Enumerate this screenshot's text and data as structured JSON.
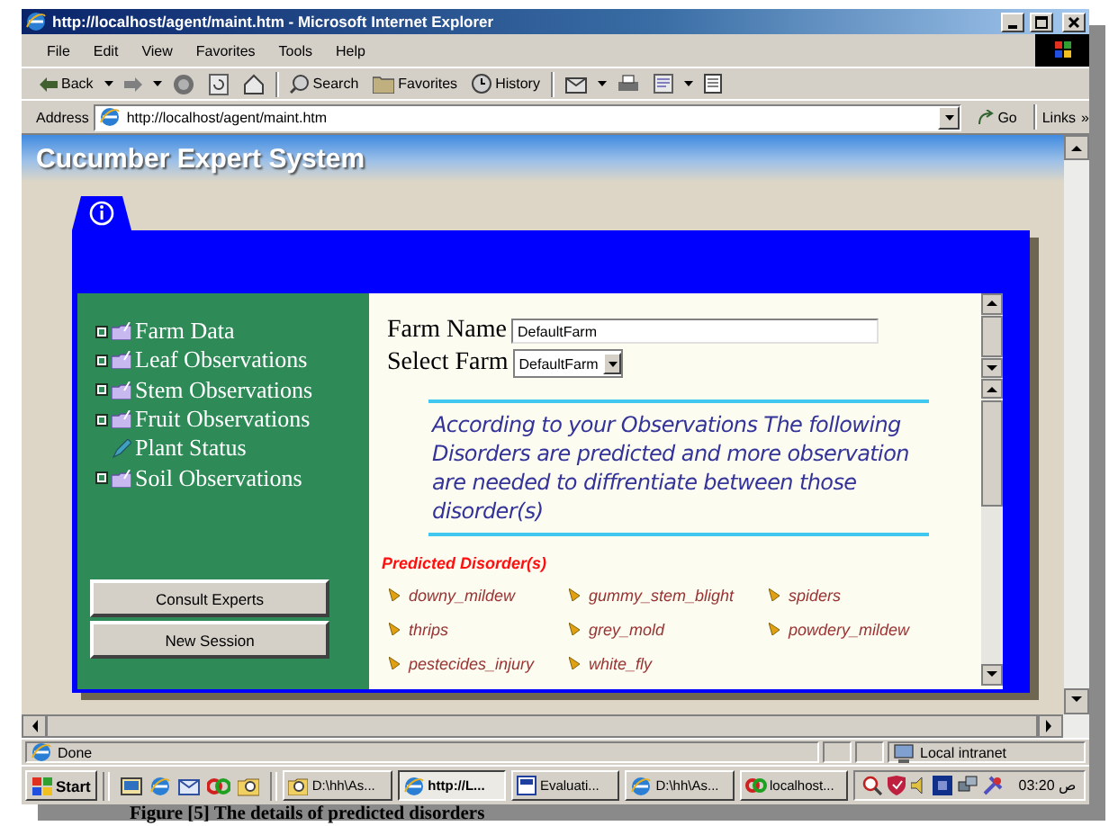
{
  "window": {
    "title": "http://localhost/agent/maint.htm - Microsoft Internet Explorer"
  },
  "menu": [
    "File",
    "Edit",
    "View",
    "Favorites",
    "Tools",
    "Help"
  ],
  "toolbar": [
    "Back",
    "Search",
    "Favorites",
    "History"
  ],
  "address": {
    "label": "Address",
    "value": "http://localhost/agent/maint.htm",
    "go": "Go",
    "links": "Links",
    "chevron": "»"
  },
  "page": {
    "title": "Cucumber Expert System",
    "sidebar": {
      "items": [
        {
          "label": "Farm Data",
          "kind": "folder"
        },
        {
          "label": "Leaf Observations",
          "kind": "folder"
        },
        {
          "label": "Stem Observations",
          "kind": "folder"
        },
        {
          "label": "Fruit Observations",
          "kind": "folder"
        },
        {
          "label": "Plant Status",
          "kind": "leaf"
        },
        {
          "label": "Soil Observations",
          "kind": "folder"
        }
      ],
      "buttons": [
        "Consult Experts",
        "New Session"
      ]
    },
    "form": {
      "farm_name": {
        "label": "Farm Name",
        "value": "DefaultFarm"
      },
      "select_farm": {
        "label": "Select Farm",
        "value": "DefaultFarm"
      }
    },
    "notice": "According to your Observations The following Disorders are predicted and more observation are needed to diffrentiate between those disorder(s)",
    "predicted": {
      "heading": "Predicted Disorder(s)",
      "disorders": [
        "downy_mildew",
        "gummy_stem_blight",
        "spiders",
        "thrips",
        "grey_mold",
        "powdery_mildew",
        "pestecides_injury",
        "white_fly"
      ]
    }
  },
  "status_bar": {
    "text": "Done",
    "zone": "Local intranet"
  },
  "taskbar": {
    "start": "Start",
    "tasks": [
      {
        "label": "D:\\hh\\As...",
        "selected": false
      },
      {
        "label": "http://L...",
        "selected": true
      },
      {
        "label": "Evaluati...",
        "selected": false
      },
      {
        "label": "D:\\hh\\As...",
        "selected": false
      },
      {
        "label": "localhost...",
        "selected": false
      }
    ],
    "clock": "03:20 ص"
  },
  "caption": "Figure [5] The details of predicted disorders"
}
